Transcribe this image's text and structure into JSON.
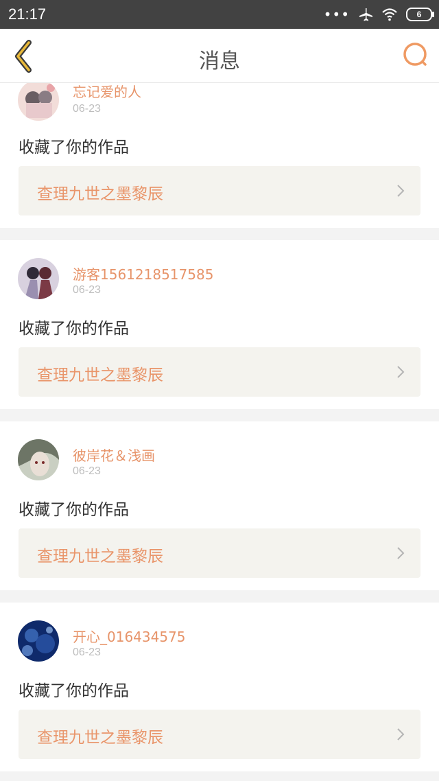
{
  "status_bar": {
    "time": "21:17",
    "signal_dots": "•••",
    "battery_level": "6"
  },
  "header": {
    "title": "消息"
  },
  "accent_color": "#e7946a",
  "messages": [
    {
      "user": "忘记爱的人",
      "date": "06-23",
      "action": "收藏了你的作品",
      "work_title": "查理九世之墨黎辰"
    },
    {
      "user": "游客1561218517585",
      "date": "06-23",
      "action": "收藏了你的作品",
      "work_title": "查理九世之墨黎辰"
    },
    {
      "user": "彼岸花＆浅画",
      "date": "06-23",
      "action": "收藏了你的作品",
      "work_title": "查理九世之墨黎辰"
    },
    {
      "user": "开心_016434575",
      "date": "06-23",
      "action": "收藏了你的作品",
      "work_title": "查理九世之墨黎辰"
    }
  ]
}
